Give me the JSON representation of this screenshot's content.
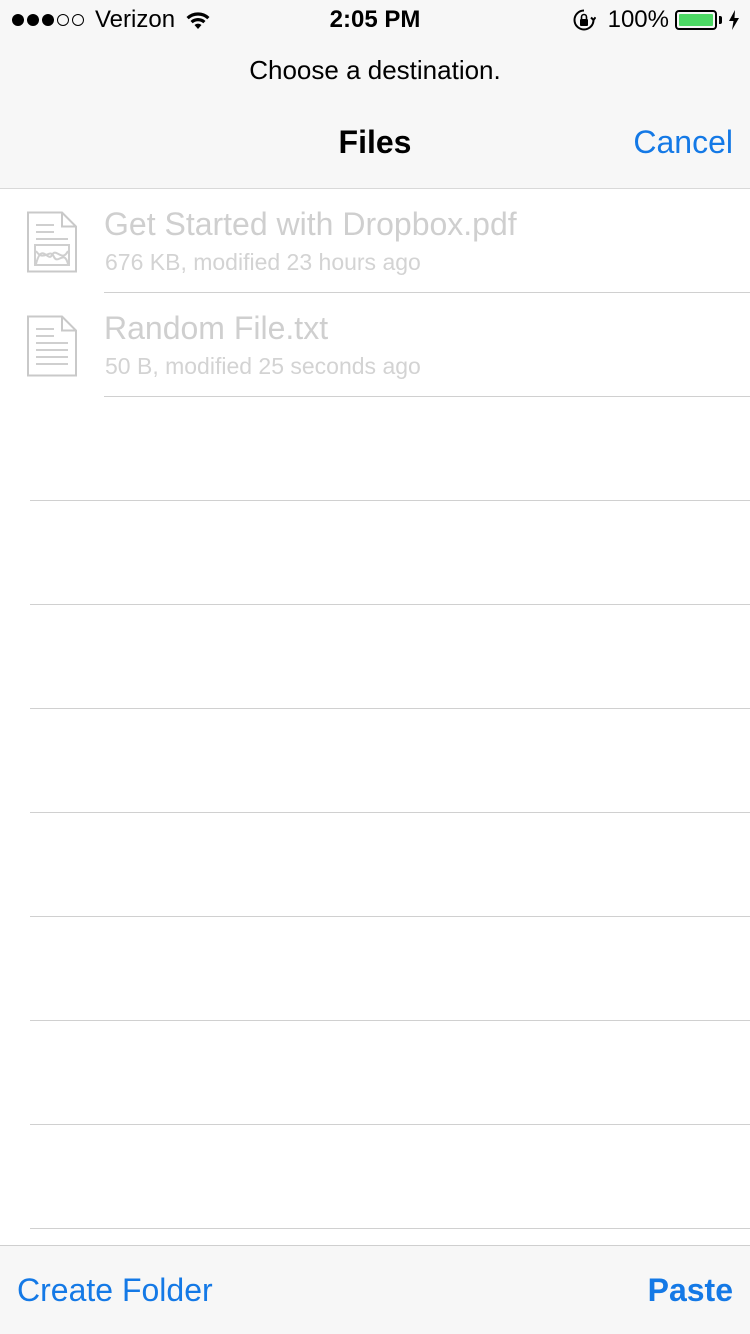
{
  "status_bar": {
    "signal_filled": 3,
    "signal_total": 5,
    "carrier": "Verizon",
    "time": "2:05 PM",
    "battery_percent": "100%",
    "battery_level": 1.0,
    "battery_color": "#4cd964",
    "icons": [
      "signal-dots-icon",
      "wifi-icon",
      "rotation-lock-icon",
      "battery-icon",
      "charging-bolt-icon"
    ]
  },
  "header": {
    "prompt": "Choose a destination.",
    "title": "Files",
    "cancel_label": "Cancel"
  },
  "files": [
    {
      "name": "Get Started with Dropbox.pdf",
      "meta": "676 KB, modified 23 hours ago",
      "icon": "pdf-file-icon"
    },
    {
      "name": "Random File.txt",
      "meta": "50 B, modified 25 seconds ago",
      "icon": "text-file-icon"
    }
  ],
  "toolbar": {
    "create_folder_label": "Create Folder",
    "paste_label": "Paste"
  },
  "colors": {
    "accent": "#1479e6",
    "disabled_text": "#cfcfcf",
    "bar_background": "#f7f7f7"
  }
}
